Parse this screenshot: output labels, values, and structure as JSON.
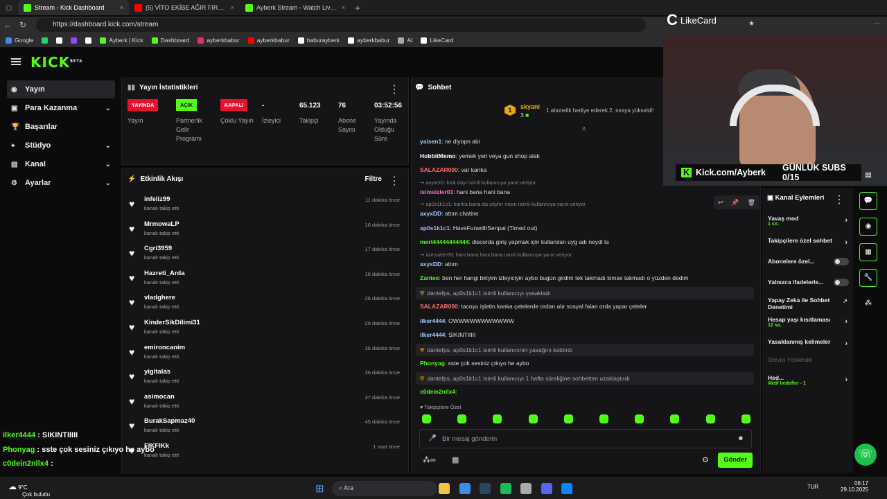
{
  "browser": {
    "tabs": [
      {
        "title": "Stream - Kick Dashboard",
        "color": "#53fc18"
      },
      {
        "title": "(5) VİTO EKİBE AĞIR FIRÇA ATIYOR",
        "color": "#ff0000"
      },
      {
        "title": "Ayberk Stream - Watch Live on Kick",
        "color": "#53fc18"
      }
    ],
    "url": "https://dashboard.kick.com/stream",
    "bookmarks": [
      "Google",
      "",
      "",
      "",
      "",
      "Ayberk | Kick",
      "Dashboard",
      "ayberkbabur",
      "ayberkbabur",
      "baburayberk",
      "ayberkbabur",
      "AI",
      "LikeCard"
    ]
  },
  "logo": "KICK",
  "logo_beta": "BETA",
  "sidebar": [
    {
      "label": "Yayın",
      "icon": "broadcast-icon",
      "active": true,
      "chev": false
    },
    {
      "label": "Para Kazanma",
      "icon": "money-icon",
      "chev": true
    },
    {
      "label": "Başarılar",
      "icon": "trophy-icon",
      "chev": false
    },
    {
      "label": "Stüdyo",
      "icon": "studio-icon",
      "chev": true
    },
    {
      "label": "Kanal",
      "icon": "channel-icon",
      "chev": true
    },
    {
      "label": "Ayarlar",
      "icon": "gear-icon",
      "chev": true
    }
  ],
  "stats": {
    "title": "Yayın İstatistikleri",
    "cols": [
      {
        "badge": "YAYINDA",
        "badge_color": "#e8112d",
        "label": "Yayın"
      },
      {
        "badge": "AÇIK",
        "badge_color": "#53fc18",
        "label": "Partnerlik Gelir Programı"
      },
      {
        "badge": "KAPALI",
        "badge_color": "#e8112d",
        "label": "Çoklu Yayın"
      },
      {
        "value": "-",
        "label": "İzleyici"
      },
      {
        "value": "65.123",
        "label": "Takipçi"
      },
      {
        "value": "76",
        "label": "Abone Sayısı"
      },
      {
        "value": "03:52:56",
        "label": "Yayında Olduğu Süre"
      }
    ]
  },
  "activity": {
    "title": "Etkinlik Akışı",
    "filter": "Filtre",
    "items": [
      {
        "name": "infeliz99",
        "sub": "kanalı takip etti",
        "time": "11 dakika önce"
      },
      {
        "name": "MrmowaLP",
        "sub": "kanalı takip etti",
        "time": "16 dakika önce"
      },
      {
        "name": "Cgri3959",
        "sub": "kanalı takip etti",
        "time": "17 dakika önce"
      },
      {
        "name": "Hazreti_Arda",
        "sub": "kanalı takip etti",
        "time": "18 dakika önce"
      },
      {
        "name": "vladghere",
        "sub": "kanalı takip etti",
        "time": "28 dakika önce"
      },
      {
        "name": "KinderSikDilimi31",
        "sub": "kanalı takip etti",
        "time": "29 dakika önce"
      },
      {
        "name": "emironcanim",
        "sub": "kanalı takip etti",
        "time": "36 dakika önce"
      },
      {
        "name": "yigitalas",
        "sub": "kanalı takip etti",
        "time": "36 dakika önce"
      },
      {
        "name": "asimocan",
        "sub": "kanalı takip etti",
        "time": "37 dakika önce"
      },
      {
        "name": "BurakSapmaz40",
        "sub": "kanalı takip etti",
        "time": "45 dakika önce"
      },
      {
        "name": "FIKFIKk",
        "sub": "kanalı takip etti",
        "time": "1 saat önce"
      }
    ]
  },
  "chat": {
    "title": "Sohbet",
    "pinned_user": "skyani",
    "pinned_count": "3",
    "pinned_rank": "1",
    "pinned_text": "1 abonelik hediye ederek 2. sıraya yükseldi!",
    "lines": [
      {
        "type": "msg",
        "user": "yaisen1",
        "color": "#9ecbff",
        "text": "ne diyopn abi"
      },
      {
        "type": "msg",
        "user": "HobbitMemo",
        "color": "#ffffff",
        "text": "yemek yeri veya gun shop alak"
      },
      {
        "type": "msg",
        "user": "SALAZAR000",
        "color": "#ff6b6b",
        "text": "var kanka"
      },
      {
        "type": "reply",
        "text": "axyxDD: kick dayı isimli kullanıcıya yanıt veriyor"
      },
      {
        "type": "msg",
        "user": "isimsizler03",
        "color": "#ff6bd6",
        "text": "hani bana hani bana"
      },
      {
        "type": "reply",
        "text": "ap0s1k1c1: kanka bana da söyler misin isimli kullanıcıya yanıt veriyor"
      },
      {
        "type": "msg",
        "user": "axyxDD",
        "color": "#9ecbff",
        "text": "attım chatine"
      },
      {
        "type": "msg",
        "user": "ap0s1k1c1",
        "color": "#c9a0ff",
        "text": "HaveFunwithSenpai (Timed out)"
      },
      {
        "type": "msg",
        "user": "mert44444444444",
        "color": "#53fc18",
        "text": "discorda giriş yapmak için kullanılan uyg adı neydi la"
      },
      {
        "type": "reply",
        "text": "isimsizler03: hani bana hani bana isimli kullanıcıya yanıt veriyor"
      },
      {
        "type": "msg",
        "user": "axyxDD",
        "color": "#9ecbff",
        "text": "attım"
      },
      {
        "type": "msg",
        "user": "Zantee",
        "color": "#53fc18",
        "text": "ben her hangi biriyim izleyiciyin aybo bugün girdim tek takmadı kimse takmadı o yüzden dedim"
      },
      {
        "type": "sys",
        "text": "dantefps, ap0s1k1c1 isimli kullanıcıyı yasakladı"
      },
      {
        "type": "msg",
        "user": "SALAZAR000",
        "color": "#ff6b6b",
        "text": "tacoyu işletin kanka çetelerde ordan alır sosyal falan orda yapar çeteler"
      },
      {
        "type": "msg",
        "user": "ilker4444",
        "color": "#9ecbff",
        "text": "OWWWWWWWWWWW"
      },
      {
        "type": "msg",
        "user": "ilker4444",
        "color": "#9ecbff",
        "text": "SIKINTIIIII"
      },
      {
        "type": "sys",
        "text": "dantefps, ap0s1k1c1 isimli kullanıcının yasağını kaldırdı"
      },
      {
        "type": "msg",
        "user": "Phonyag",
        "color": "#53fc18",
        "text": "sste çok sesiniz çıkıyo he aybo"
      },
      {
        "type": "sys",
        "text": "dantefps, ap0s1k1c1 isimli kullanıcıyı 1 hafta süreliğine sohbetten uzaklaştırdı"
      },
      {
        "type": "msg",
        "user": "c0dein2nllx4",
        "color": "#53fc18",
        "text": ""
      }
    ],
    "followers_only": "Takipçilere Özel",
    "input_placeholder": "Bir mesaj gönderin",
    "send": "Gönder"
  },
  "overlay": {
    "brand": "LikeCard",
    "kick_url": "Kick.com/Ayberk",
    "subs_goal": "GÜNLÜK SUBS 0/15",
    "chat": [
      {
        "user": "ilker4444",
        "text": " : SIKINTIIIII"
      },
      {
        "user": "Phonyag",
        "text": " : sste çok sesiniz çıkıyo he aybo"
      },
      {
        "user": "c0dein2nllx4",
        "text": " : "
      }
    ]
  },
  "mod": {
    "title": "Kanal Eylemleri",
    "items": [
      {
        "label": "Yavaş mod",
        "sub": "1 sn.",
        "kind": "arrow"
      },
      {
        "label": "Takipçilere özel sohbet",
        "kind": "arrow"
      },
      {
        "label": "Abonelere özel...",
        "kind": "toggle"
      },
      {
        "label": "Yalnızca ifadelerle...",
        "kind": "toggle"
      },
      {
        "label": "Yapay Zeka ile Sohbet Denetimi",
        "kind": "ext"
      },
      {
        "label": "Hesap yaşı kısıtlaması",
        "sub": "12 sa.",
        "kind": "arrow"
      },
      {
        "label": "Yasaklanmış kelimeler",
        "kind": "arrow"
      },
      {
        "label": "İzleyici Yönlendir",
        "kind": "disabled"
      },
      {
        "label": "Hed...",
        "sub": "Aktif hedefler - 1",
        "kind": "arrow"
      }
    ]
  },
  "taskbar": {
    "weather_temp": "9°C",
    "weather_desc": "Çok bulutlu",
    "search": "Ara",
    "lang": "TUR",
    "time": "06:17",
    "date": "29.10.2025"
  }
}
